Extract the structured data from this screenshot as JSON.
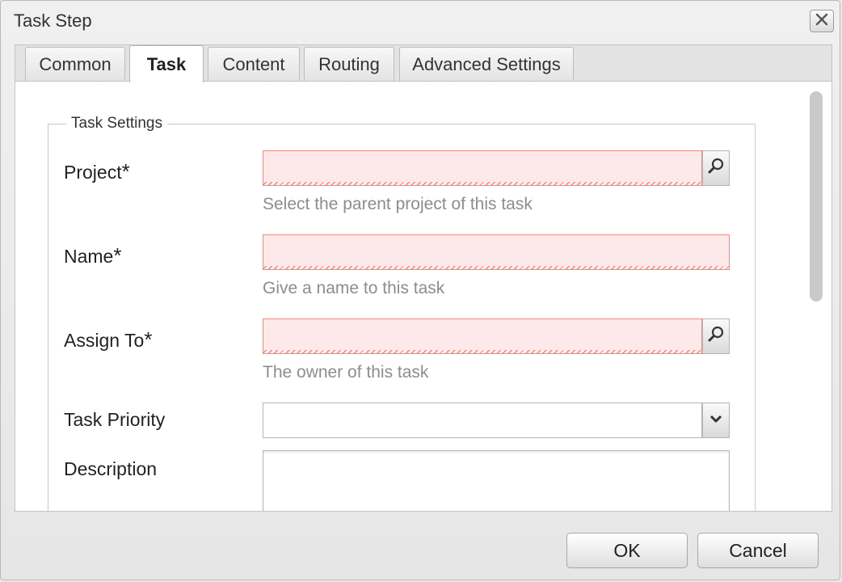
{
  "window": {
    "title": "Task Step"
  },
  "tabs": [
    {
      "label": "Common",
      "active": false
    },
    {
      "label": "Task",
      "active": true
    },
    {
      "label": "Content",
      "active": false
    },
    {
      "label": "Routing",
      "active": false
    },
    {
      "label": "Advanced Settings",
      "active": false
    }
  ],
  "section": {
    "legend": "Task Settings"
  },
  "fields": {
    "project": {
      "label": "Project",
      "required_mark": "*",
      "value": "",
      "hint": "Select the parent project of this task"
    },
    "name": {
      "label": "Name",
      "required_mark": "*",
      "value": "",
      "hint": "Give a name to this task"
    },
    "assign_to": {
      "label": "Assign To",
      "required_mark": "*",
      "value": "",
      "hint": "The owner of this task"
    },
    "task_priority": {
      "label": "Task Priority",
      "value": ""
    },
    "description": {
      "label": "Description",
      "value": ""
    }
  },
  "buttons": {
    "ok": "OK",
    "cancel": "Cancel"
  },
  "icons": {
    "close": "close-icon",
    "search": "search-icon",
    "dropdown": "chevron-down-icon"
  },
  "colors": {
    "invalid_bg": "#fde9e9",
    "invalid_border": "#f08a7e",
    "hint_text": "#8d8d8d"
  }
}
